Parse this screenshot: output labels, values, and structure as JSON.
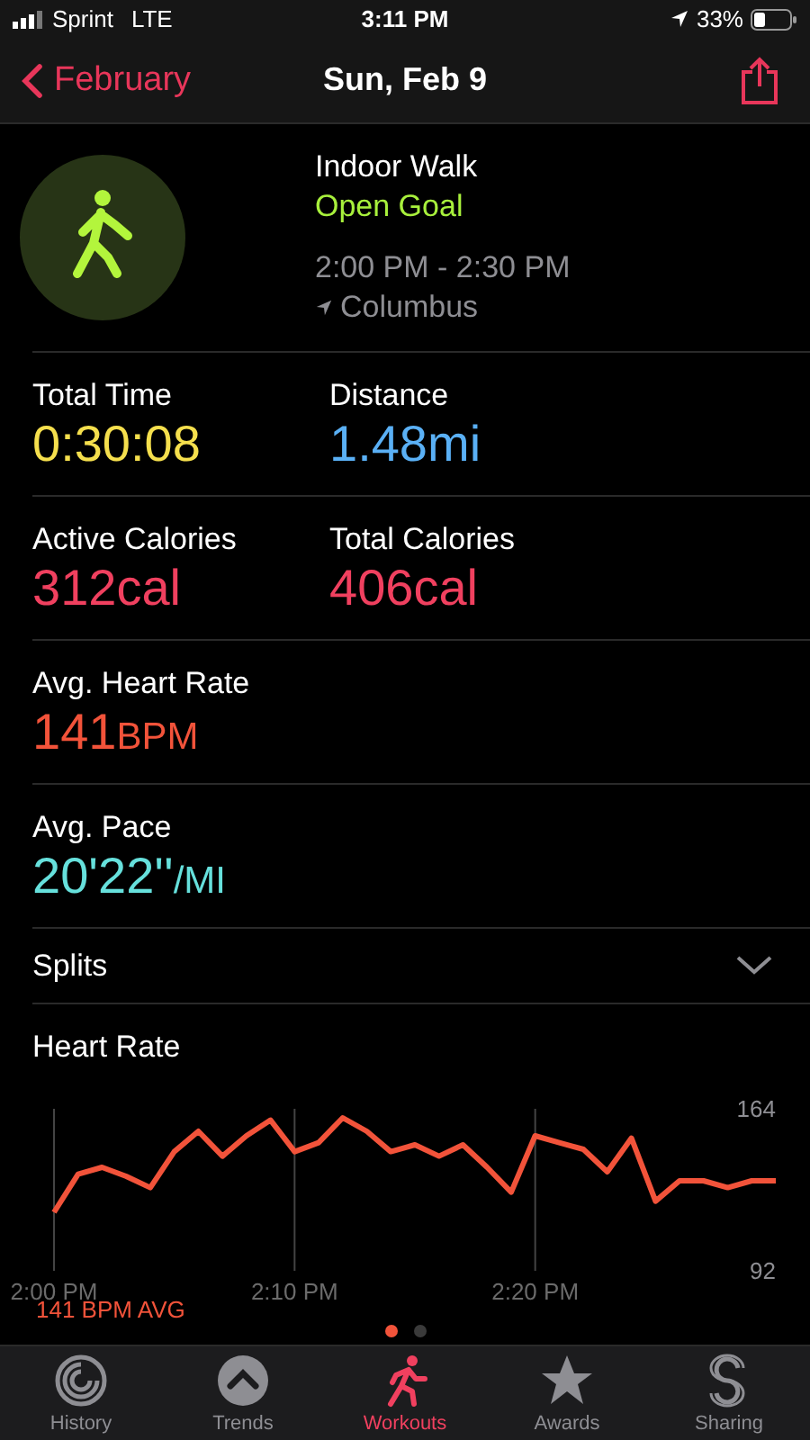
{
  "status_bar": {
    "carrier": "Sprint",
    "network": "LTE",
    "time": "3:11 PM",
    "battery": "33%"
  },
  "nav": {
    "back": "February",
    "title": "Sun, Feb 9"
  },
  "workout": {
    "name": "Indoor Walk",
    "goal": "Open Goal",
    "time_range": "2:00 PM - 2:30 PM",
    "location": "Columbus"
  },
  "metric_rows": [
    [
      {
        "label": "Total Time",
        "value": "0:30:08",
        "color": "#f5df4d"
      },
      {
        "label": "Distance",
        "value": "1.48mi",
        "color": "#5ab0f5"
      }
    ],
    [
      {
        "label": "Active Calories",
        "value": "312cal",
        "color": "#f0405f"
      },
      {
        "label": "Total Calories",
        "value": "406cal",
        "color": "#f0405f"
      }
    ],
    [
      {
        "label": "Avg. Heart Rate",
        "value": "141",
        "unit": "BPM",
        "color": "#f2533a"
      }
    ],
    [
      {
        "label": "Avg. Pace",
        "value": "20'22''",
        "unit": "/MI",
        "color": "#66e0dc"
      }
    ]
  ],
  "splits": {
    "label": "Splits",
    "expanded": false
  },
  "heart_rate": {
    "title": "Heart Rate",
    "average": "141 BPM AVG",
    "chart_data": {
      "type": "line",
      "categories": [
        "2:00 PM",
        null,
        null,
        null,
        null,
        null,
        null,
        null,
        null,
        null,
        "2:10 PM",
        null,
        null,
        null,
        null,
        null,
        null,
        null,
        null,
        null,
        "2:20 PM",
        null,
        null,
        null,
        null,
        null,
        null,
        null,
        null,
        null,
        null
      ],
      "series": [
        {
          "color": "#f2533a",
          "values": [
            118,
            135,
            138,
            134,
            129,
            145,
            154,
            143,
            152,
            159,
            145,
            149,
            160,
            154,
            145,
            148,
            143,
            148,
            138,
            127,
            152,
            149,
            146,
            136,
            151,
            123,
            132,
            132,
            129,
            132,
            132
          ]
        }
      ],
      "ylim": [
        92,
        164
      ],
      "grid": true,
      "yticks": [
        164,
        92
      ]
    }
  },
  "pager": [
    {
      "selected": true
    },
    {
      "selected": false
    }
  ],
  "tabs": [
    {
      "label": "History",
      "kind": "history",
      "selected": false
    },
    {
      "label": "Trends",
      "kind": "trends",
      "selected": false
    },
    {
      "label": "Workouts",
      "kind": "workouts",
      "selected": true
    },
    {
      "label": "Awards",
      "kind": "awards",
      "selected": false
    },
    {
      "label": "Sharing",
      "kind": "sharing",
      "selected": false
    }
  ]
}
